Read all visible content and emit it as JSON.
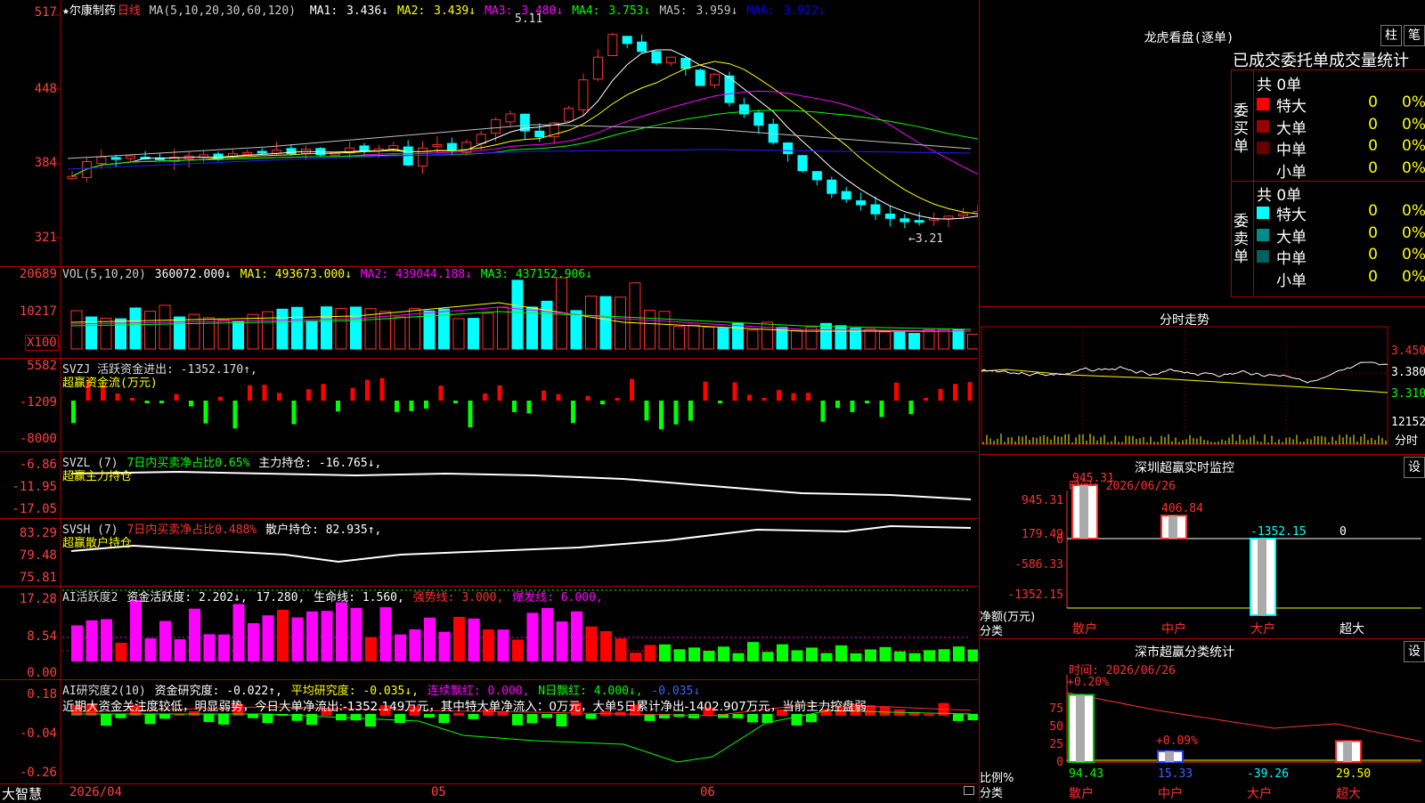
{
  "stock": {
    "name": "★尔康制药",
    "period": "日线"
  },
  "price_panel": {
    "ma_header": "MA(5,10,20,30,60,120)",
    "mas": [
      {
        "label": "MA1:",
        "value": "3.436↓",
        "color": "#ffffff"
      },
      {
        "label": "MA2:",
        "value": "3.439↓",
        "color": "#ffff00"
      },
      {
        "label": "MA3:",
        "value": "3.480↓",
        "color": "#ff00ff"
      },
      {
        "label": "MA4:",
        "value": "3.753↓",
        "color": "#00ff00"
      },
      {
        "label": "MA5:",
        "value": "3.959↓",
        "color": "#c0c0c0"
      },
      {
        "label": "MA6:",
        "value": "3.922↓",
        "color": "#0000ff"
      }
    ],
    "y_ticks": [
      "517",
      "448",
      "384",
      "321"
    ],
    "high_label": "5.11",
    "low_label": "←3.21"
  },
  "vol_panel": {
    "header_name": "VOL(5,10,20)",
    "vol": "360072.000↓",
    "ma1": "MA1: 493673.000↓",
    "ma2": "MA2: 439044.188↓",
    "ma3": "MA3: 437152.906↓",
    "y_ticks": [
      "20689",
      "10217"
    ],
    "unit": "X100"
  },
  "svzj_panel": {
    "header": "SVZJ  活跃资金进出: -1352.170↑,",
    "sub": "超赢资金流(万元)",
    "y_ticks": [
      "5582",
      "-1209",
      "-8000"
    ]
  },
  "svzl_panel": {
    "name": "SVZL (7)",
    "ratio": "7日内买卖净占比0.65%",
    "hold": "主力持仓: -16.765↓,",
    "sub": "超赢主力持仓",
    "y_ticks": [
      "-6.86",
      "-11.95",
      "-17.05"
    ]
  },
  "svsh_panel": {
    "name": "SVSH (7)",
    "ratio": "7日内买卖净占比0.488%",
    "hold": "散户持仓: 82.935↑,",
    "sub": "超赢散户持仓",
    "y_ticks": [
      "83.29",
      "79.48",
      "75.81"
    ]
  },
  "ai_active_panel": {
    "name": "AI活跃度2",
    "active": "资金活跃度: 2.202↓,",
    "v2": "17.280,",
    "life": "生命线: 1.560,",
    "strong": "强势线: 3.000,",
    "burst": "爆发线: 6.000,",
    "y_ticks": [
      "17.28",
      "8.54",
      "0.00"
    ]
  },
  "ai_research_panel": {
    "name": "AI研究度2(10)",
    "research": "资金研究度: -0.022↑,",
    "avg": "平均研究度: -0.035↓,",
    "red": "连续飘红: 0.000,",
    "nred": "N日飘红: 4.000↓,",
    "last": "-0.035↓",
    "comment": "近期大资金关注度较低，明显弱势，今日大单净流出:-1352.149万元，其中特大单净流入：0万元，大单5日累计净出-1402.907万元，当前主力控盘弱",
    "y_ticks": [
      "0.18",
      "-0.04",
      "-0.26"
    ]
  },
  "bottom_axis": {
    "brand": "大智慧",
    "date": "2026/04",
    "m05": "05",
    "m06": "06"
  },
  "dragon_tiger": {
    "title": "龙虎看盘(逐单)",
    "btn_bar": "柱",
    "btn_deal": "笔",
    "subtitle": "已成交委托单成交量统计",
    "buy_group": "委买单",
    "sell_group": "委卖单",
    "buy_total": "共 0单",
    "sell_total": "共 0单",
    "rows": [
      {
        "name": "特大",
        "count": "0",
        "pct": "0%"
      },
      {
        "name": "大单",
        "count": "0",
        "pct": "0%"
      },
      {
        "name": "中单",
        "count": "0",
        "pct": "0%"
      },
      {
        "name": "小单",
        "count": "0",
        "pct": "0%"
      }
    ],
    "buy_colors": [
      "#ff0000",
      "#990000",
      "#660000",
      ""
    ],
    "sell_colors": [
      "#00ffff",
      "#008b8b",
      "#006060",
      ""
    ]
  },
  "intraday": {
    "title": "分时走势",
    "prices": [
      "3.450",
      "3.380",
      "3.310"
    ],
    "vol": "12152",
    "label": "分时"
  },
  "realtime_monitor": {
    "title": "深圳超赢实时监控",
    "btn": "设",
    "time": "时间: 2026/06/26",
    "y_ticks": [
      "945.31",
      "179.49",
      "0",
      "-586.33",
      "-1352.15"
    ],
    "y_label": "净额(万元)",
    "x_label": "分类",
    "values": [
      {
        "cat": "散户",
        "value": "945.31",
        "num": 945.31,
        "color": "#ff3030"
      },
      {
        "cat": "中户",
        "value": "406.84",
        "num": 406.84,
        "color": "#ff3030"
      },
      {
        "cat": "大户",
        "value": "-1352.15",
        "num": -1352.15,
        "color": "#00ffff"
      },
      {
        "cat": "超大",
        "value": "0",
        "num": 0,
        "color": "#ffffff"
      }
    ]
  },
  "class_stats": {
    "title": "深市超赢分类统计",
    "btn": "设",
    "time": "时间: 2026/06/26",
    "y_ticks": [
      "75",
      "50",
      "25",
      "0"
    ],
    "y_label": "比例%",
    "x_label": "分类",
    "top_labels": [
      {
        "text": "+0.20%",
        "color": "#ff3030"
      },
      {
        "text": "+0.09%",
        "color": "#ff3030"
      }
    ],
    "bars": [
      {
        "cat": "散户",
        "value": "94.43",
        "num": 94.43,
        "color": "#00ff00",
        "fill": "#00c000"
      },
      {
        "cat": "中户",
        "value": "15.33",
        "num": 15.33,
        "color": "#4060ff",
        "fill": "#2040ff"
      },
      {
        "cat": "大户",
        "value": "-39.26",
        "num": 0,
        "color": "#00ffff",
        "fill": "#00ffff"
      },
      {
        "cat": "超大",
        "value": "29.50",
        "num": 29.5,
        "color": "#ffff00",
        "fill": "#ff2020"
      }
    ]
  }
}
